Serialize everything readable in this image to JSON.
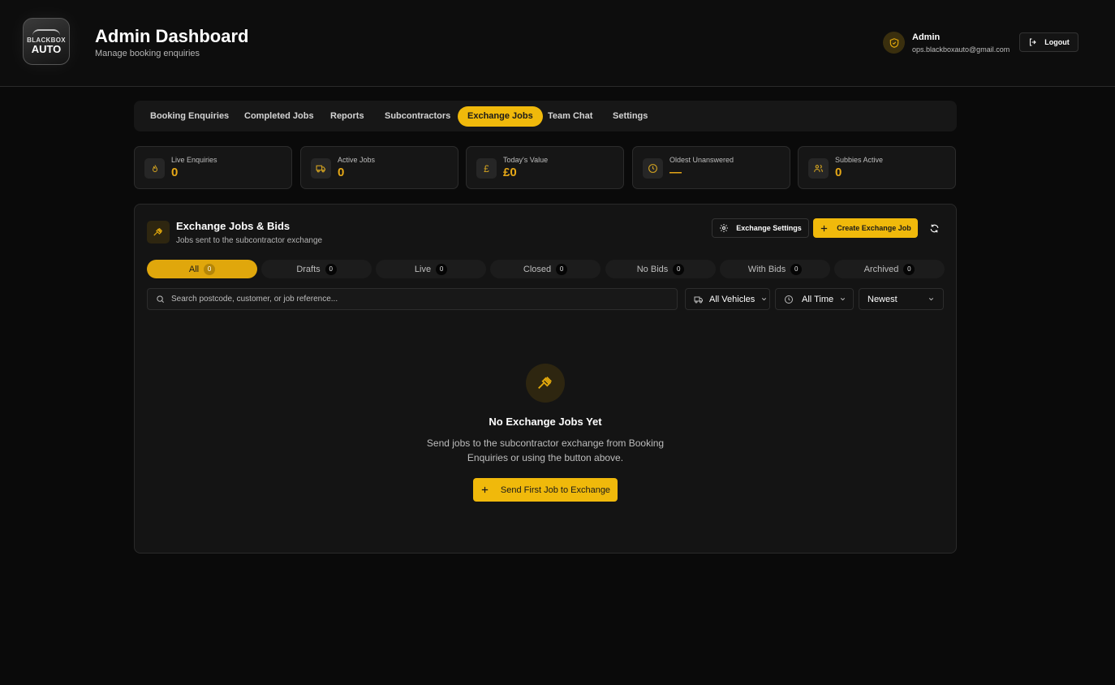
{
  "header": {
    "logo_top": "BLACKBOX",
    "logo_bottom": "AUTO",
    "title": "Admin Dashboard",
    "subtitle": "Manage booking enquiries",
    "user_name": "Admin",
    "user_email": "ops.blackboxauto@gmail.com",
    "logout_label": "Logout"
  },
  "nav": {
    "items": [
      {
        "label": "Booking Enquiries"
      },
      {
        "label": "Completed Jobs"
      },
      {
        "label": "Reports"
      },
      {
        "label": "Subcontractors"
      },
      {
        "label": "Exchange Jobs",
        "active": true
      },
      {
        "label": "Team Chat"
      },
      {
        "label": "Settings"
      }
    ]
  },
  "stats": [
    {
      "label": "Live Enquiries",
      "value": "0",
      "icon": "flame-icon"
    },
    {
      "label": "Active Jobs",
      "value": "0",
      "icon": "truck-icon"
    },
    {
      "label": "Today's Value",
      "value": "£0",
      "icon": "pound-icon"
    },
    {
      "label": "Oldest Unanswered",
      "value": "—",
      "icon": "clock-icon"
    },
    {
      "label": "Subbies Active",
      "value": "0",
      "icon": "users-icon"
    }
  ],
  "panel": {
    "title": "Exchange Jobs & Bids",
    "subtitle": "Jobs sent to the subcontractor exchange",
    "settings_label": "Exchange Settings",
    "create_label": "Create Exchange Job",
    "filters": [
      {
        "label": "All",
        "count": "0",
        "active": true
      },
      {
        "label": "Drafts",
        "count": "0"
      },
      {
        "label": "Live",
        "count": "0"
      },
      {
        "label": "Closed",
        "count": "0"
      },
      {
        "label": "No Bids",
        "count": "0"
      },
      {
        "label": "With Bids",
        "count": "0"
      },
      {
        "label": "Archived",
        "count": "0"
      }
    ],
    "search_placeholder": "Search postcode, customer, or job reference...",
    "vehicle_select": "All Vehicles",
    "time_select": "All Time",
    "sort_select": "Newest",
    "empty_title": "No Exchange Jobs Yet",
    "empty_text": "Send jobs to the subcontractor exchange from Booking Enquiries or using the button above.",
    "empty_button": "Send First Job to Exchange"
  },
  "colors": {
    "accent": "#f0b90b",
    "background": "#0a0a0a",
    "panel": "#141414"
  }
}
